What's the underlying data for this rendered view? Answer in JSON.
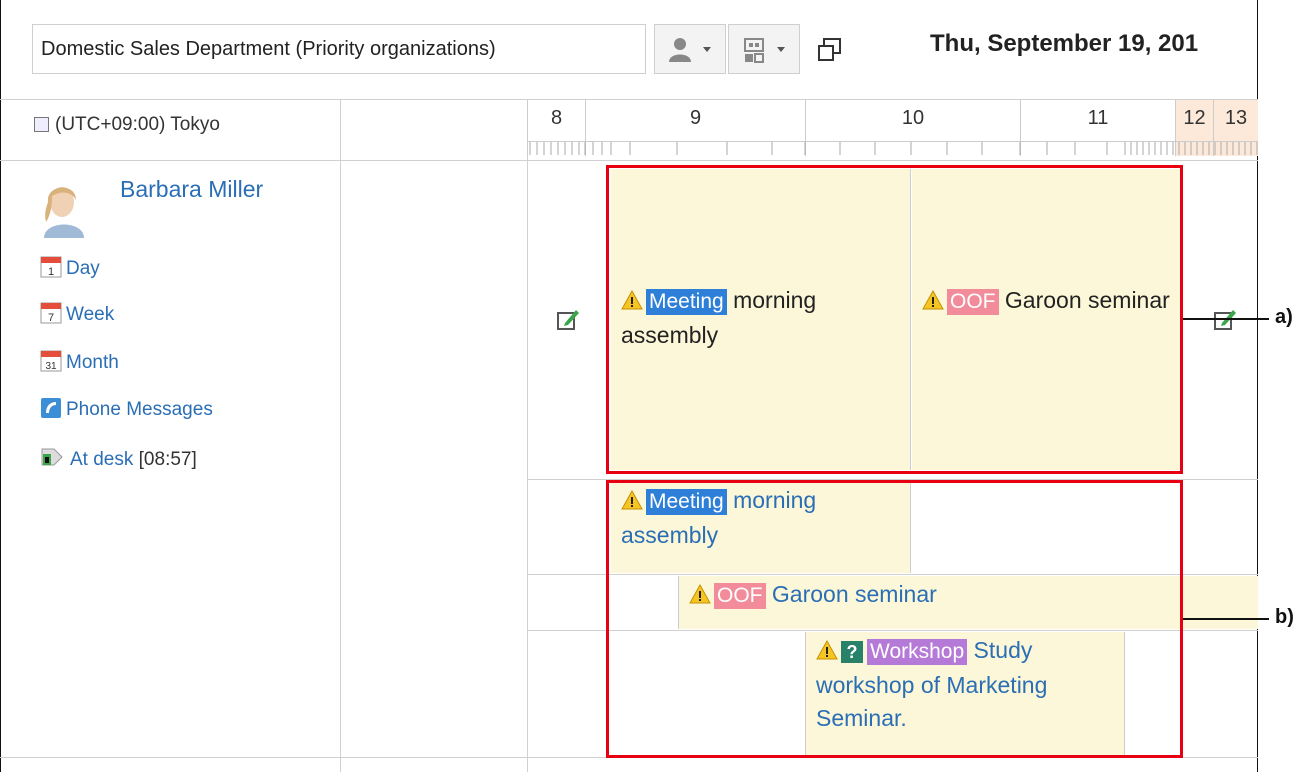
{
  "toolbar": {
    "organization": "Domestic Sales Department (Priority organizations)",
    "date_title": "Thu, September 19, 201"
  },
  "timezone": "(UTC+09:00) Tokyo",
  "hours": [
    "8",
    "9",
    "10",
    "11",
    "12",
    "13"
  ],
  "user": {
    "name": "Barbara Miller",
    "menu": {
      "day": "Day",
      "week": "Week",
      "month": "Month",
      "phone": "Phone Messages",
      "presence": "At desk",
      "presence_time": "[08:57]",
      "day_num": "1",
      "week_num": "7",
      "month_num": "31"
    }
  },
  "events_a": [
    {
      "badge": "Meeting",
      "badge_color": "#2d7fd8",
      "title": "morning assembly"
    },
    {
      "badge": "OOF",
      "badge_color": "#f28c9a",
      "title": "Garoon seminar"
    }
  ],
  "events_b": [
    {
      "badge": "Meeting",
      "badge_color": "#2d7fd8",
      "title": "morning assembly"
    },
    {
      "badge": "OOF",
      "badge_color": "#f28c9a",
      "title": "Garoon seminar"
    },
    {
      "badge": "Workshop",
      "badge_color": "#b57ad8",
      "title": "Study workshop of Marketing Seminar."
    }
  ],
  "callouts": {
    "a": "a)",
    "b": "b)"
  },
  "colors": {
    "link": "#2a6eb5",
    "event_bg": "#fbf7d8",
    "highlight": "#e60012",
    "lunch": "#fde9d9"
  }
}
